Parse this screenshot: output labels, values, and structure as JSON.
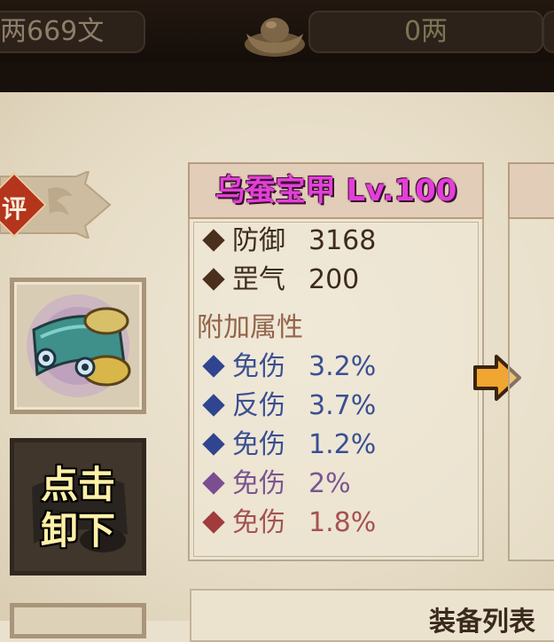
{
  "currency": {
    "copper": "两669文",
    "silver": "0两"
  },
  "grade_tag": "评",
  "item": {
    "title": "乌蚕宝甲 Lv.100",
    "base_stats": [
      {
        "name": "防御",
        "value": "3168"
      },
      {
        "name": "罡气",
        "value": "200"
      }
    ],
    "extra_header": "附加属性",
    "extra_stats": [
      {
        "name": "免伤",
        "value": "3.2%",
        "quality": "blue"
      },
      {
        "name": "反伤",
        "value": "3.7%",
        "quality": "blue"
      },
      {
        "name": "免伤",
        "value": "1.2%",
        "quality": "blue"
      },
      {
        "name": "免伤",
        "value": "2%",
        "quality": "purple"
      },
      {
        "name": "免伤",
        "value": "1.8%",
        "quality": "red"
      }
    ]
  },
  "unload_button": {
    "line1": "点击",
    "line2": "卸下"
  },
  "list_title": "装备列表",
  "icons": {
    "ingot": "gold-ingot-icon",
    "armor": "armor-item-icon",
    "arrow": "compare-arrow-icon"
  },
  "colors": {
    "title": "#e33fd8",
    "blue_stat": "#3a4f93",
    "purple_stat": "#7b5590",
    "red_stat": "#a55252"
  }
}
